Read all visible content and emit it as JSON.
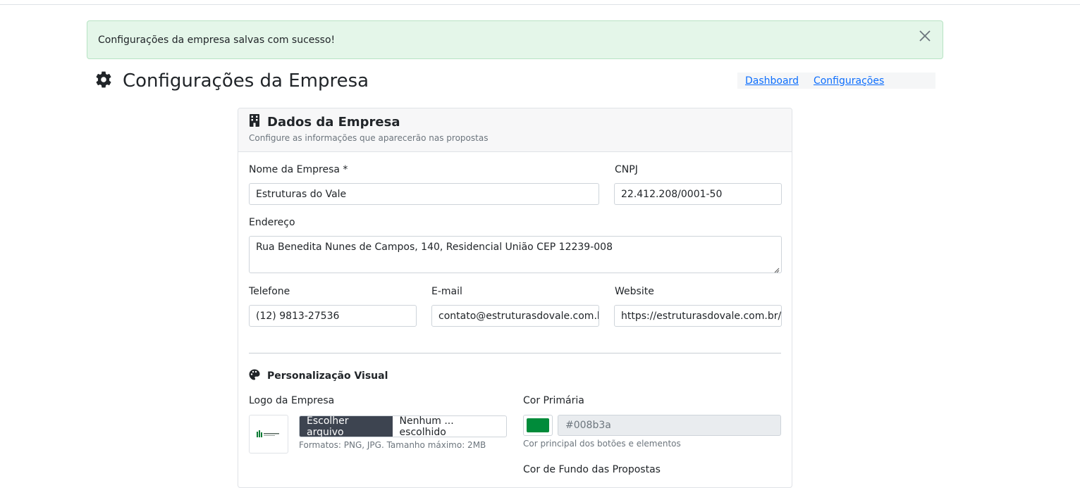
{
  "alert": {
    "message": "Configurações da empresa salvas com sucesso!"
  },
  "page": {
    "title": "Configurações da Empresa"
  },
  "breadcrumb": {
    "items": [
      "Dashboard",
      "Configurações"
    ]
  },
  "card": {
    "title": "Dados da Empresa",
    "subtitle": "Configure as informações que aparecerão nas propostas"
  },
  "form": {
    "company_name": {
      "label": "Nome da Empresa *",
      "value": "Estruturas do Vale"
    },
    "cnpj": {
      "label": "CNPJ",
      "value": "22.412.208/0001-50"
    },
    "address": {
      "label": "Endereço",
      "value": "Rua Benedita Nunes de Campos, 140, Residencial União CEP 12239-008"
    },
    "phone": {
      "label": "Telefone",
      "value": "(12) 9813-27536"
    },
    "email": {
      "label": "E-mail",
      "value": "contato@estruturasdovale.com.br"
    },
    "website": {
      "label": "Website",
      "value": "https://estruturasdovale.com.br/"
    }
  },
  "visual": {
    "section_title": "Personalização Visual",
    "logo": {
      "label": "Logo da Empresa",
      "button": "Escolher arquivo",
      "file_name": "Nenhum ... escolhido",
      "help": "Formatos: PNG, JPG. Tamanho máximo: 2MB"
    },
    "primary_color": {
      "label": "Cor Primária",
      "value": "#008b3a",
      "help": "Cor principal dos botões e elementos"
    },
    "background_color": {
      "label": "Cor de Fundo das Propostas"
    }
  },
  "colors": {
    "alert_bg": "#e4f6e9",
    "link": "#0d6efd",
    "primary_swatch": "#008b3a"
  }
}
